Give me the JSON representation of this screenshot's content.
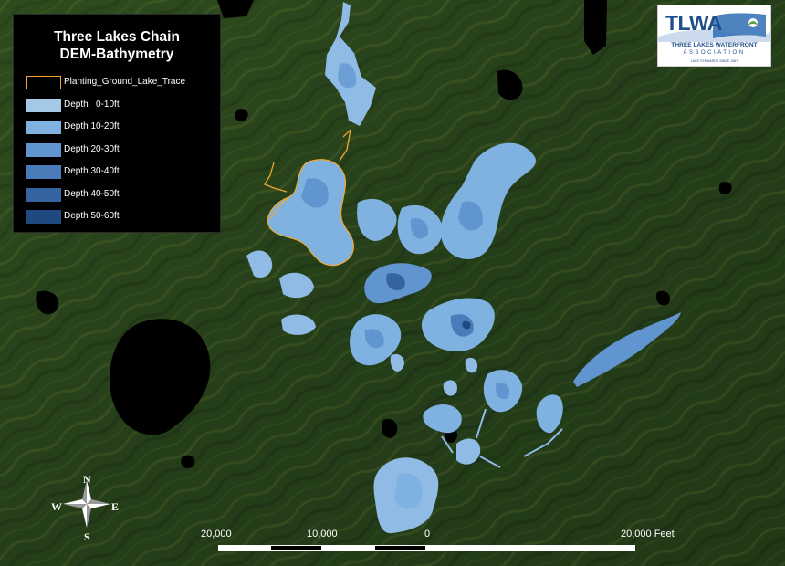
{
  "legend": {
    "title_line1": "Three Lakes Chain",
    "title_line2": "DEM-Bathymetry",
    "items": [
      {
        "label": "Planting_Ground_Lake_Trace",
        "fill": "none",
        "stroke": "#f0a832"
      },
      {
        "label": "Depth   0-10ft",
        "fill": "#a4c8e8",
        "stroke": "none"
      },
      {
        "label": "Depth 10-20ft",
        "fill": "#7fb2e0",
        "stroke": "none"
      },
      {
        "label": "Depth 20-30ft",
        "fill": "#6095cf",
        "stroke": "none"
      },
      {
        "label": "Depth 30-40ft",
        "fill": "#4a7cba",
        "stroke": "none"
      },
      {
        "label": "Depth 40-50ft",
        "fill": "#3664a0",
        "stroke": "none"
      },
      {
        "label": "Depth 50-60ft",
        "fill": "#1f4a80",
        "stroke": "none"
      }
    ]
  },
  "logo": {
    "mark": "TLWA",
    "line1": "THREE LAKES WATERFRONT",
    "line2": "ASSOCIATION",
    "line3": "LAKE STEWARDS SINCE 1987",
    "color": "#1f4e8c"
  },
  "scale_bar": {
    "labels": [
      "20,000",
      "10,000",
      "0",
      "20,000 Feet"
    ]
  },
  "compass": {
    "n": "N",
    "s": "S",
    "e": "E",
    "w": "W"
  },
  "colors": {
    "terrain": "#2c4a1e",
    "water_shallow": "#a4c8e8",
    "water_deep": "#1f4a80",
    "trace": "#f0a832",
    "other_lakes": "#000000"
  }
}
